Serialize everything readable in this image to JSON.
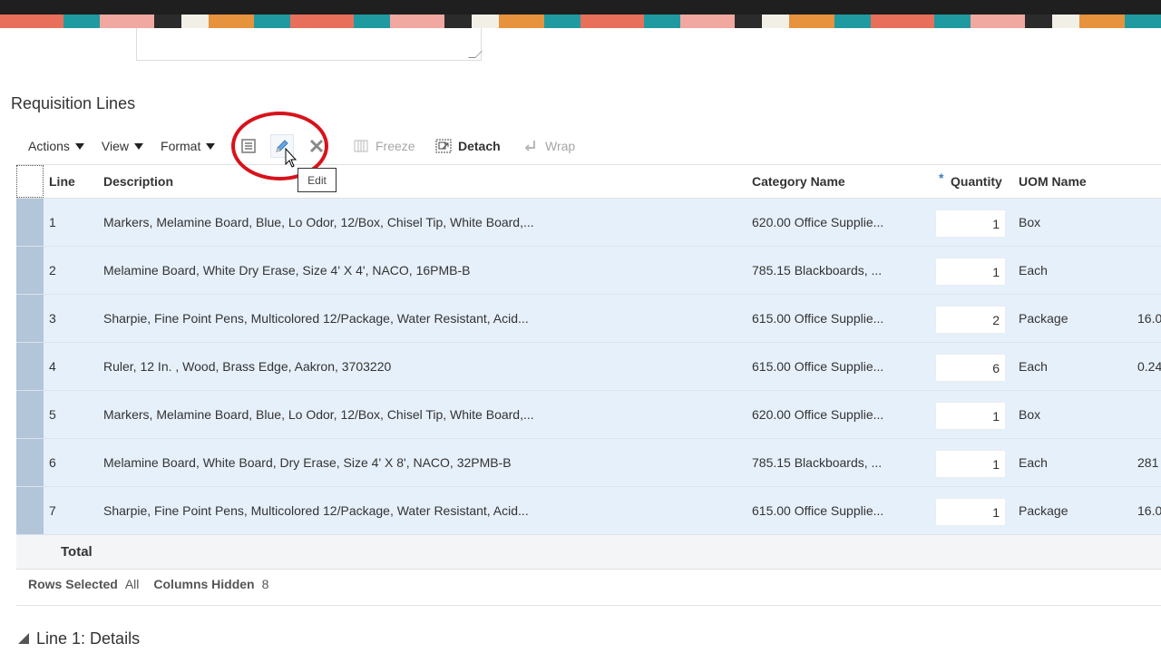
{
  "section": {
    "title": "Requisition Lines"
  },
  "toolbar": {
    "actions_label": "Actions",
    "view_label": "View",
    "format_label": "Format",
    "freeze_label": "Freeze",
    "detach_label": "Detach",
    "wrap_label": "Wrap",
    "edit_tooltip": "Edit"
  },
  "table": {
    "columns": {
      "line": "Line",
      "description": "Description",
      "category": "Category Name",
      "quantity": "Quantity",
      "quantity_required": "*",
      "uom": "UOM Name"
    },
    "rows": [
      {
        "line": "1",
        "description": "Markers, Melamine Board, Blue, Lo Odor, 12/Box, Chisel Tip, White Board,...",
        "category": "620.00 Office Supplie...",
        "quantity": "1",
        "uom": "Box",
        "extra": ""
      },
      {
        "line": "2",
        "description": "Melamine Board, White Dry Erase, Size 4' X 4', NACO, 16PMB-B",
        "category": "785.15 Blackboards, ...",
        "quantity": "1",
        "uom": "Each",
        "extra": ""
      },
      {
        "line": "3",
        "description": "Sharpie, Fine Point Pens, Multicolored 12/Package, Water Resistant, Acid...",
        "category": "615.00 Office Supplie...",
        "quantity": "2",
        "uom": "Package",
        "extra": "16.0"
      },
      {
        "line": "4",
        "description": "Ruler, 12 In. , Wood, Brass Edge, Aakron, 3703220",
        "category": "615.00 Office Supplie...",
        "quantity": "6",
        "uom": "Each",
        "extra": "0.24"
      },
      {
        "line": "5",
        "description": "Markers, Melamine Board, Blue, Lo Odor, 12/Box, Chisel Tip, White Board,...",
        "category": "620.00 Office Supplie...",
        "quantity": "1",
        "uom": "Box",
        "extra": ""
      },
      {
        "line": "6",
        "description": "Melamine Board, White Board, Dry Erase, Size 4' X 8', NACO, 32PMB-B",
        "category": "785.15 Blackboards, ...",
        "quantity": "1",
        "uom": "Each",
        "extra": "281"
      },
      {
        "line": "7",
        "description": "Sharpie, Fine Point Pens, Multicolored 12/Package, Water Resistant, Acid...",
        "category": "615.00 Office Supplie...",
        "quantity": "1",
        "uom": "Package",
        "extra": "16.0"
      }
    ],
    "total_label": "Total"
  },
  "status": {
    "rows_selected_label": "Rows Selected",
    "rows_selected_value": "All",
    "columns_hidden_label": "Columns Hidden",
    "columns_hidden_value": "8"
  },
  "details": {
    "title": "Line 1: Details"
  },
  "colors": {
    "row_bg": "#e6f0fb",
    "selection_bar": "#b3c5d8",
    "highlight_circle": "#d8131b",
    "edit_icon": "#3a7fc2"
  }
}
